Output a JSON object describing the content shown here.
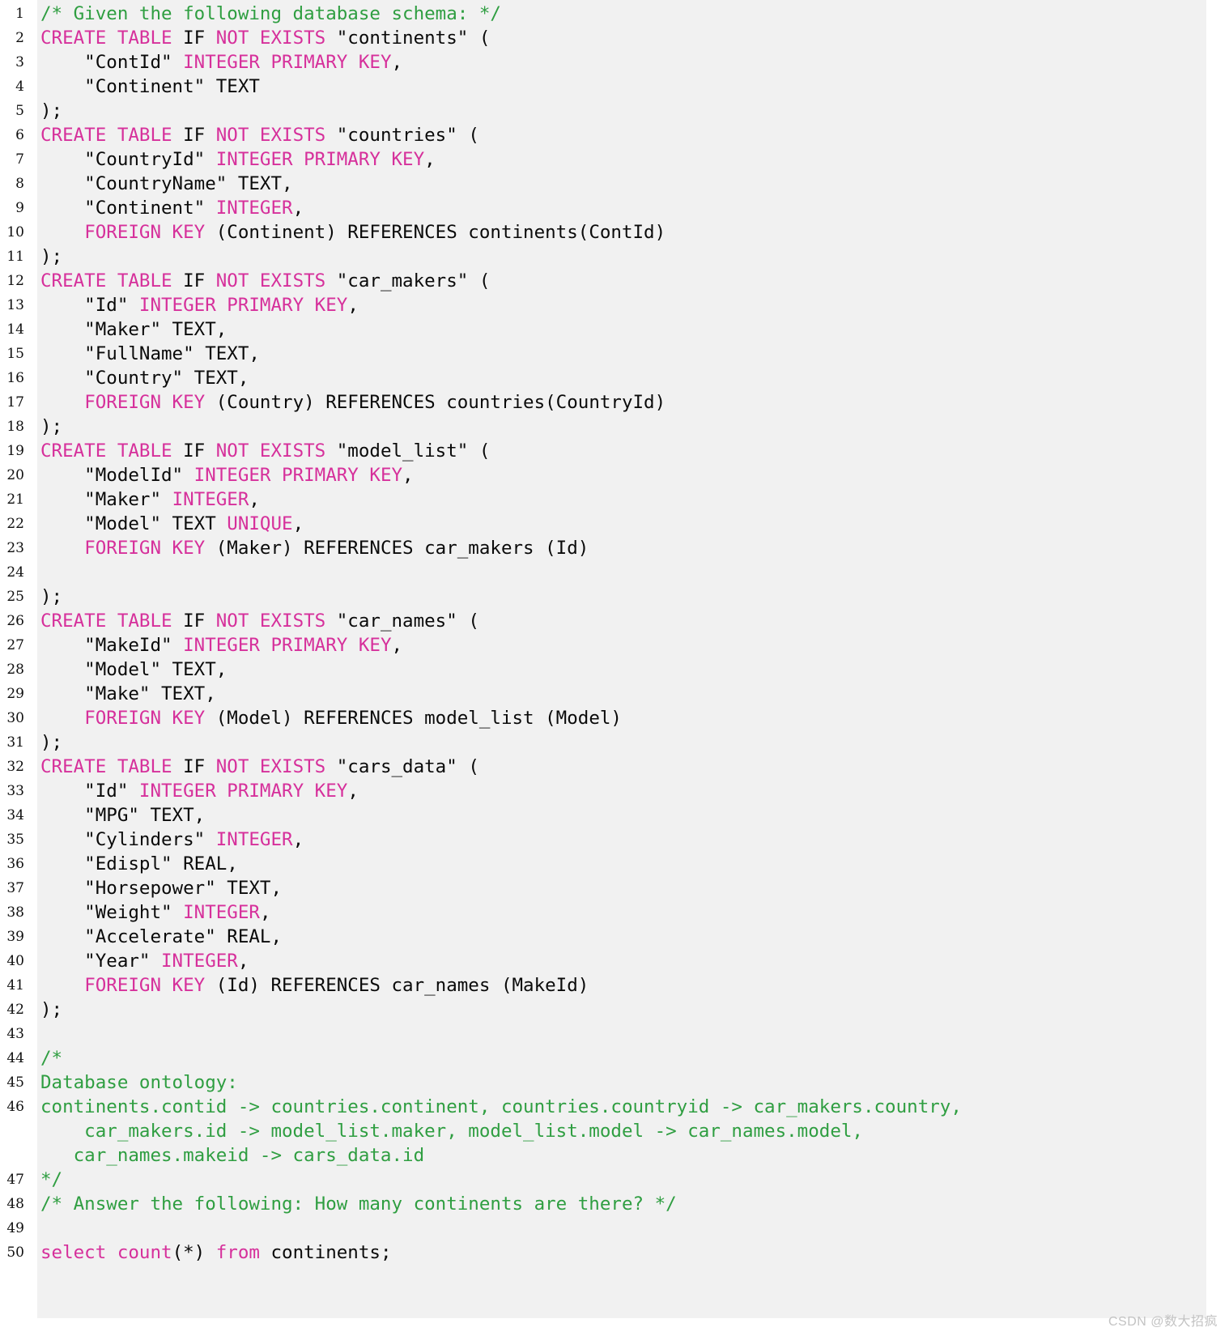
{
  "editor": {
    "language": "sql",
    "background_color": "#f1f1f1",
    "gutter_color": "#ffffff",
    "keyword_color": "#d6309b",
    "comment_color": "#2f9e41",
    "text_color": "#0a0a0a",
    "first_line": 1,
    "last_line": 50
  },
  "watermark": {
    "text": "CSDN @数大招疯"
  },
  "lines": [
    {
      "n": "1",
      "tokens": [
        {
          "t": "cm",
          "v": "/* Given the following database schema: */"
        }
      ]
    },
    {
      "n": "2",
      "tokens": [
        {
          "t": "k",
          "v": "CREATE TABLE "
        },
        {
          "t": "pl",
          "v": "IF "
        },
        {
          "t": "k",
          "v": "NOT EXISTS "
        },
        {
          "t": "pl",
          "v": "\"continents\" ("
        }
      ]
    },
    {
      "n": "3",
      "tokens": [
        {
          "t": "pl",
          "v": "    \"ContId\" "
        },
        {
          "t": "k",
          "v": "INTEGER PRIMARY KEY"
        },
        {
          "t": "pl",
          "v": ","
        }
      ]
    },
    {
      "n": "4",
      "tokens": [
        {
          "t": "pl",
          "v": "    \"Continent\" TEXT"
        }
      ]
    },
    {
      "n": "5",
      "tokens": [
        {
          "t": "pl",
          "v": ");"
        }
      ]
    },
    {
      "n": "6",
      "tokens": [
        {
          "t": "k",
          "v": "CREATE TABLE "
        },
        {
          "t": "pl",
          "v": "IF "
        },
        {
          "t": "k",
          "v": "NOT EXISTS "
        },
        {
          "t": "pl",
          "v": "\"countries\" ("
        }
      ]
    },
    {
      "n": "7",
      "tokens": [
        {
          "t": "pl",
          "v": "    \"CountryId\" "
        },
        {
          "t": "k",
          "v": "INTEGER PRIMARY KEY"
        },
        {
          "t": "pl",
          "v": ","
        }
      ]
    },
    {
      "n": "8",
      "tokens": [
        {
          "t": "pl",
          "v": "    \"CountryName\" TEXT,"
        }
      ]
    },
    {
      "n": "9",
      "tokens": [
        {
          "t": "pl",
          "v": "    \"Continent\" "
        },
        {
          "t": "k",
          "v": "INTEGER"
        },
        {
          "t": "pl",
          "v": ","
        }
      ]
    },
    {
      "n": "10",
      "tokens": [
        {
          "t": "pl",
          "v": "    "
        },
        {
          "t": "k",
          "v": "FOREIGN KEY "
        },
        {
          "t": "pl",
          "v": "(Continent) REFERENCES continents(ContId)"
        }
      ]
    },
    {
      "n": "11",
      "tokens": [
        {
          "t": "pl",
          "v": ");"
        }
      ]
    },
    {
      "n": "12",
      "tokens": [
        {
          "t": "k",
          "v": "CREATE TABLE "
        },
        {
          "t": "pl",
          "v": "IF "
        },
        {
          "t": "k",
          "v": "NOT EXISTS "
        },
        {
          "t": "pl",
          "v": "\"car_makers\" ("
        }
      ]
    },
    {
      "n": "13",
      "tokens": [
        {
          "t": "pl",
          "v": "    \"Id\" "
        },
        {
          "t": "k",
          "v": "INTEGER PRIMARY KEY"
        },
        {
          "t": "pl",
          "v": ","
        }
      ]
    },
    {
      "n": "14",
      "tokens": [
        {
          "t": "pl",
          "v": "    \"Maker\" TEXT,"
        }
      ]
    },
    {
      "n": "15",
      "tokens": [
        {
          "t": "pl",
          "v": "    \"FullName\" TEXT,"
        }
      ]
    },
    {
      "n": "16",
      "tokens": [
        {
          "t": "pl",
          "v": "    \"Country\" TEXT,"
        }
      ]
    },
    {
      "n": "17",
      "tokens": [
        {
          "t": "pl",
          "v": "    "
        },
        {
          "t": "k",
          "v": "FOREIGN KEY "
        },
        {
          "t": "pl",
          "v": "(Country) REFERENCES countries(CountryId)"
        }
      ]
    },
    {
      "n": "18",
      "tokens": [
        {
          "t": "pl",
          "v": ");"
        }
      ]
    },
    {
      "n": "19",
      "tokens": [
        {
          "t": "k",
          "v": "CREATE TABLE "
        },
        {
          "t": "pl",
          "v": "IF "
        },
        {
          "t": "k",
          "v": "NOT EXISTS "
        },
        {
          "t": "pl",
          "v": "\"model_list\" ("
        }
      ]
    },
    {
      "n": "20",
      "tokens": [
        {
          "t": "pl",
          "v": "    \"ModelId\" "
        },
        {
          "t": "k",
          "v": "INTEGER PRIMARY KEY"
        },
        {
          "t": "pl",
          "v": ","
        }
      ]
    },
    {
      "n": "21",
      "tokens": [
        {
          "t": "pl",
          "v": "    \"Maker\" "
        },
        {
          "t": "k",
          "v": "INTEGER"
        },
        {
          "t": "pl",
          "v": ","
        }
      ]
    },
    {
      "n": "22",
      "tokens": [
        {
          "t": "pl",
          "v": "    \"Model\" TEXT "
        },
        {
          "t": "k",
          "v": "UNIQUE"
        },
        {
          "t": "pl",
          "v": ","
        }
      ]
    },
    {
      "n": "23",
      "tokens": [
        {
          "t": "pl",
          "v": "    "
        },
        {
          "t": "k",
          "v": "FOREIGN KEY "
        },
        {
          "t": "pl",
          "v": "(Maker) REFERENCES car_makers (Id)"
        }
      ]
    },
    {
      "n": "24",
      "tokens": [
        {
          "t": "pl",
          "v": ""
        }
      ]
    },
    {
      "n": "25",
      "tokens": [
        {
          "t": "pl",
          "v": ");"
        }
      ]
    },
    {
      "n": "26",
      "tokens": [
        {
          "t": "k",
          "v": "CREATE TABLE "
        },
        {
          "t": "pl",
          "v": "IF "
        },
        {
          "t": "k",
          "v": "NOT EXISTS "
        },
        {
          "t": "pl",
          "v": "\"car_names\" ("
        }
      ]
    },
    {
      "n": "27",
      "tokens": [
        {
          "t": "pl",
          "v": "    \"MakeId\" "
        },
        {
          "t": "k",
          "v": "INTEGER PRIMARY KEY"
        },
        {
          "t": "pl",
          "v": ","
        }
      ]
    },
    {
      "n": "28",
      "tokens": [
        {
          "t": "pl",
          "v": "    \"Model\" TEXT,"
        }
      ]
    },
    {
      "n": "29",
      "tokens": [
        {
          "t": "pl",
          "v": "    \"Make\" TEXT,"
        }
      ]
    },
    {
      "n": "30",
      "tokens": [
        {
          "t": "pl",
          "v": "    "
        },
        {
          "t": "k",
          "v": "FOREIGN KEY "
        },
        {
          "t": "pl",
          "v": "(Model) REFERENCES model_list (Model)"
        }
      ]
    },
    {
      "n": "31",
      "tokens": [
        {
          "t": "pl",
          "v": ");"
        }
      ]
    },
    {
      "n": "32",
      "tokens": [
        {
          "t": "k",
          "v": "CREATE TABLE "
        },
        {
          "t": "pl",
          "v": "IF "
        },
        {
          "t": "k",
          "v": "NOT EXISTS "
        },
        {
          "t": "pl",
          "v": "\"cars_data\" ("
        }
      ]
    },
    {
      "n": "33",
      "tokens": [
        {
          "t": "pl",
          "v": "    \"Id\" "
        },
        {
          "t": "k",
          "v": "INTEGER PRIMARY KEY"
        },
        {
          "t": "pl",
          "v": ","
        }
      ]
    },
    {
      "n": "34",
      "tokens": [
        {
          "t": "pl",
          "v": "    \"MPG\" TEXT,"
        }
      ]
    },
    {
      "n": "35",
      "tokens": [
        {
          "t": "pl",
          "v": "    \"Cylinders\" "
        },
        {
          "t": "k",
          "v": "INTEGER"
        },
        {
          "t": "pl",
          "v": ","
        }
      ]
    },
    {
      "n": "36",
      "tokens": [
        {
          "t": "pl",
          "v": "    \"Edispl\" REAL,"
        }
      ]
    },
    {
      "n": "37",
      "tokens": [
        {
          "t": "pl",
          "v": "    \"Horsepower\" TEXT,"
        }
      ]
    },
    {
      "n": "38",
      "tokens": [
        {
          "t": "pl",
          "v": "    \"Weight\" "
        },
        {
          "t": "k",
          "v": "INTEGER"
        },
        {
          "t": "pl",
          "v": ","
        }
      ]
    },
    {
      "n": "39",
      "tokens": [
        {
          "t": "pl",
          "v": "    \"Accelerate\" REAL,"
        }
      ]
    },
    {
      "n": "40",
      "tokens": [
        {
          "t": "pl",
          "v": "    \"Year\" "
        },
        {
          "t": "k",
          "v": "INTEGER"
        },
        {
          "t": "pl",
          "v": ","
        }
      ]
    },
    {
      "n": "41",
      "tokens": [
        {
          "t": "pl",
          "v": "    "
        },
        {
          "t": "k",
          "v": "FOREIGN KEY "
        },
        {
          "t": "pl",
          "v": "(Id) REFERENCES car_names (MakeId)"
        }
      ]
    },
    {
      "n": "42",
      "tokens": [
        {
          "t": "pl",
          "v": ");"
        }
      ]
    },
    {
      "n": "43",
      "tokens": [
        {
          "t": "pl",
          "v": ""
        }
      ]
    },
    {
      "n": "44",
      "tokens": [
        {
          "t": "cm",
          "v": "/*"
        }
      ]
    },
    {
      "n": "45",
      "tokens": [
        {
          "t": "cm",
          "v": "Database ontology:"
        }
      ]
    },
    {
      "n": "46",
      "tall": true,
      "tokens": [
        {
          "t": "cm",
          "v": "continents.contid -> countries.continent, countries.countryid -> car_makers.country,\n    car_makers.id -> model_list.maker, model_list.model -> car_names.model,\n   car_names.makeid -> cars_data.id"
        }
      ]
    },
    {
      "n": "47",
      "tokens": [
        {
          "t": "cm",
          "v": "*/"
        }
      ]
    },
    {
      "n": "48",
      "tokens": [
        {
          "t": "cm",
          "v": "/* Answer the following: How many continents are there? */"
        }
      ]
    },
    {
      "n": "49",
      "tokens": [
        {
          "t": "pl",
          "v": ""
        }
      ]
    },
    {
      "n": "50",
      "tokens": [
        {
          "t": "k",
          "v": "select count"
        },
        {
          "t": "pl",
          "v": "(*) "
        },
        {
          "t": "k",
          "v": "from "
        },
        {
          "t": "pl",
          "v": "continents;"
        }
      ]
    }
  ]
}
